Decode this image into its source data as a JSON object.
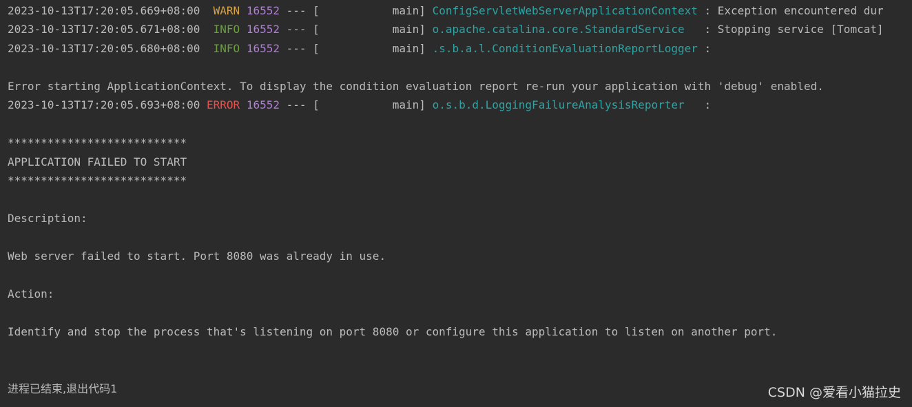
{
  "colors": {
    "background": "#2b2b2b",
    "text": "#bbbbbb",
    "warn": "#d9a343",
    "info": "#6a9f3c",
    "error": "#e8534d",
    "pid": "#b07ed6",
    "logger": "#2ea3a3"
  },
  "log_lines": [
    {
      "timestamp": "2023-10-13T17:20:05.669+08:00",
      "level": " WARN",
      "pid": "16552",
      "separator": "--- [",
      "thread": "           main]",
      "logger": "ConfigServletWebServerApplicationContext",
      "message": ": Exception encountered dur"
    },
    {
      "timestamp": "2023-10-13T17:20:05.671+08:00",
      "level": " INFO",
      "pid": "16552",
      "separator": "--- [",
      "thread": "           main]",
      "logger": "o.apache.catalina.core.StandardService  ",
      "message": ": Stopping service [Tomcat]"
    },
    {
      "timestamp": "2023-10-13T17:20:05.680+08:00",
      "level": " INFO",
      "pid": "16552",
      "separator": "--- [",
      "thread": "           main]",
      "logger": ".s.b.a.l.ConditionEvaluationReportLogger",
      "message": ":"
    }
  ],
  "error_starting_text": "Error starting ApplicationContext. To display the condition evaluation report re-run your application with 'debug' enabled.",
  "error_line": {
    "timestamp": "2023-10-13T17:20:05.693+08:00",
    "level": "ERROR",
    "pid": "16552",
    "separator": "--- [",
    "thread": "           main]",
    "logger": "o.s.b.d.LoggingFailureAnalysisReporter  ",
    "message": ":"
  },
  "banner": {
    "stars_top": "***************************",
    "title": "APPLICATION FAILED TO START",
    "stars_bottom": "***************************"
  },
  "description_label": "Description:",
  "description_text": "Web server failed to start. Port 8080 was already in use.",
  "action_label": "Action:",
  "action_text": "Identify and stop the process that's listening on port 8080 or configure this application to listen on another port.",
  "exit_message": "进程已结束,退出代码1",
  "watermark": "CSDN @爱看小猫拉史"
}
